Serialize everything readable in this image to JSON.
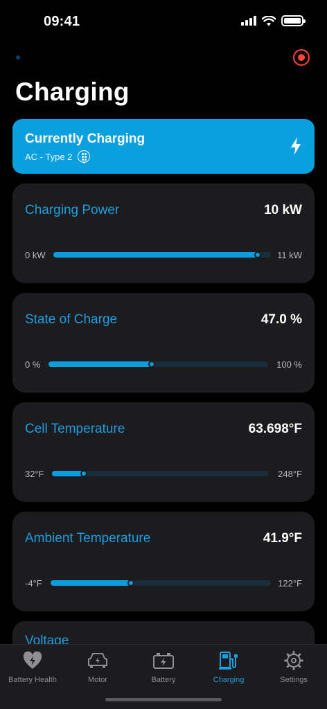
{
  "status": {
    "time": "09:41"
  },
  "page": {
    "title": "Charging"
  },
  "banner": {
    "title": "Currently Charging",
    "subtitle": "AC - Type 2",
    "connector_icon": "type2-plug-icon",
    "action_icon": "bolt-icon"
  },
  "metrics": [
    {
      "title": "Charging Power",
      "value": "10 kW",
      "min": "0 kW",
      "max": "11 kW",
      "fraction": 0.94
    },
    {
      "title": "State of Charge",
      "value": "47.0 %",
      "min": "0 %",
      "max": "100 %",
      "fraction": 0.47
    },
    {
      "title": "Cell Temperature",
      "value": "63.698°F",
      "min": "32°F",
      "max": "248°F",
      "fraction": 0.146
    },
    {
      "title": "Ambient Temperature",
      "value": "41.9°F",
      "min": "-4°F",
      "max": "122°F",
      "fraction": 0.365
    },
    {
      "title": "Voltage"
    }
  ],
  "tabs": [
    {
      "label": "Battery Health",
      "icon": "heart-bolt-icon",
      "active": false
    },
    {
      "label": "Motor",
      "icon": "car-motor-icon",
      "active": false
    },
    {
      "label": "Battery",
      "icon": "battery-icon",
      "active": false
    },
    {
      "label": "Charging",
      "icon": "ev-charger-icon",
      "active": true
    },
    {
      "label": "Settings",
      "icon": "gear-icon",
      "active": false
    }
  ],
  "colors": {
    "accent": "#0aa0e0",
    "card": "#1c1c1e",
    "record": "#ff453a"
  }
}
